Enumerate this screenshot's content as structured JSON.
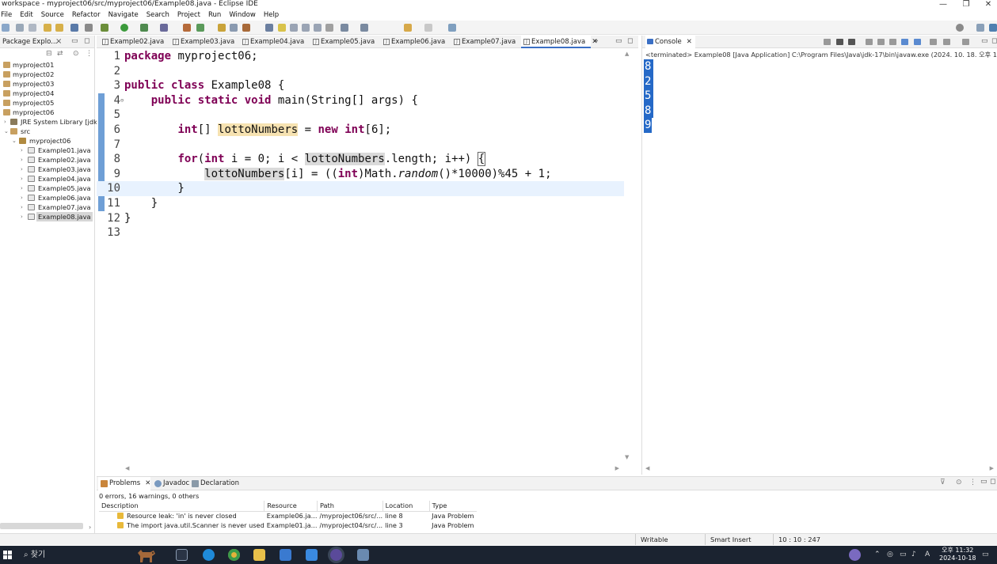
{
  "window": {
    "title": "workspace - myproject06/src/myproject06/Example08.java - Eclipse IDE",
    "controls": [
      "—",
      "❐",
      "✕"
    ]
  },
  "menu": [
    "File",
    "Edit",
    "Source",
    "Refactor",
    "Navigate",
    "Search",
    "Project",
    "Run",
    "Window",
    "Help"
  ],
  "package_explorer": {
    "tab_label": "Package Explo...",
    "projects": [
      "myproject01",
      "myproject02",
      "myproject03",
      "myproject04",
      "myproject05",
      "myproject06"
    ],
    "jre": "JRE System Library [jdk-17]",
    "src": "src",
    "package": "myproject06",
    "files": [
      "Example01.java",
      "Example02.java",
      "Example03.java",
      "Example04.java",
      "Example05.java",
      "Example06.java",
      "Example07.java",
      "Example08.java"
    ],
    "selected_file": "Example08.java"
  },
  "editor": {
    "tabs": [
      "Example02.java",
      "Example03.java",
      "Example04.java",
      "Example05.java",
      "Example06.java",
      "Example07.java",
      "Example08.java"
    ],
    "active_tab": "Example08.java",
    "overflow": "»",
    "line_numbers": [
      "1",
      "2",
      "3",
      "4",
      "5",
      "6",
      "7",
      "8",
      "9",
      "10",
      "11",
      "12",
      "13"
    ],
    "current_line": "10",
    "lines": {
      "l1_kw": "package",
      "l1_rest": " myproject06;",
      "l3_kw1": "public",
      "l3_kw2": "class",
      "l3_rest": " Example08 {",
      "l4_indent": "    ",
      "l4_kw1": "public",
      "l4_kw2": "static",
      "l4_kw3": "void",
      "l4_rest": " main(String[] args) {",
      "l6_indent": "        ",
      "l6_kw": "int",
      "l6_a": "[] ",
      "l6_var": "lottoNumbers",
      "l6_b": " = ",
      "l6_kw2": "new",
      "l6_c": " ",
      "l6_kw3": "int",
      "l6_d": "[6];",
      "l8_indent": "        ",
      "l8_kw": "for",
      "l8_a": "(",
      "l8_kw2": "int",
      "l8_b": " i = 0; i < ",
      "l8_var": "lottoNumbers",
      "l8_c": ".length; i++) ",
      "l8_brace": "{",
      "l9_indent": "            ",
      "l9_var": "lottoNumbers",
      "l9_a": "[i] = ((",
      "l9_kw": "int",
      "l9_b": ")Math.",
      "l9_it": "random",
      "l9_c": "()*10000)%45 + 1;",
      "l10": "        }",
      "l11": "    }",
      "l12": "}"
    }
  },
  "console": {
    "tab_label": "Console",
    "terminated": "<terminated> Example08 [Java Application] C:\\Program Files\\Java\\jdk-17\\bin\\javaw.exe  (2024. 10. 18. 오후 1:22:01 –",
    "output": [
      "8",
      "2",
      "5",
      "8",
      "9"
    ]
  },
  "problems": {
    "tabs": [
      "Problems",
      "Javadoc",
      "Declaration"
    ],
    "summary": "0 errors, 16 warnings, 0 others",
    "columns": [
      "Description",
      "Resource",
      "Path",
      "Location",
      "Type"
    ],
    "rows": [
      [
        "Resource leak: 'in' is never closed",
        "Example06.ja...",
        "/myproject06/src/...",
        "line 8",
        "Java Problem"
      ],
      [
        "The import java.util.Scanner is never used",
        "Example01.ja...",
        "/myproject04/src/...",
        "line 3",
        "Java Problem"
      ]
    ]
  },
  "status": {
    "writable": "Writable",
    "insert": "Smart Insert",
    "position": "10 : 10 : 247"
  },
  "taskbar": {
    "search": "찾기",
    "clock_time": "오후 11:32",
    "clock_date": "2024-10-18",
    "lang": "A"
  }
}
